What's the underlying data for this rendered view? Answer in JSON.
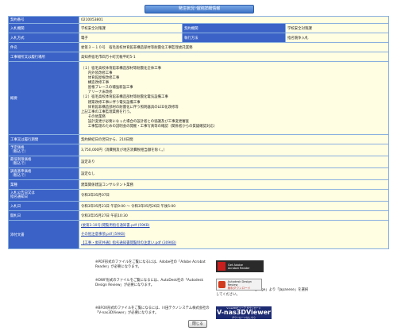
{
  "header": {
    "title": "発注状況･個別詳細情報"
  },
  "labels": {
    "contract_no": "契約番号",
    "bid_org": "入札機関",
    "contract_org": "契約機関",
    "bid_type": "入札方式",
    "exec_method": "執行方法",
    "subject": "件名",
    "site": "工事場所又は履行場所",
    "overview": "概要",
    "period": "工事又は履行期間",
    "planned_price": "予定価格\n（税込で）",
    "min_limit": "最低制限価格\n（税込で）",
    "survey_base": "調査基準価格\n（税込で）",
    "industry": "業種",
    "notice_date": "入札公告日又は\n指名通知日",
    "bid_date": "入札日",
    "open_date": "開札日",
    "attachments": "添付文書"
  },
  "values": {
    "contract_no": "0210053801",
    "bid_org": "学校安全対策課",
    "contract_org": "学校安全対策課",
    "bid_type": "電子",
    "exec_method": "指名競争入札",
    "subject": "委第３－１０号　宿毛高校体育館非構造部材等耐震化工事監理委託業務",
    "site": "高知県宿毛市四万十町元帳平町5-1",
    "overview": "（１）宿毛高校体育館非構造部材等耐震化全体工事\n　　内外装改修工事\n　　体育館屋根改修工事\n　　構造改修工事\n　　屋根ブレースの補強新設工事\n　　アリーナ床改修\n（２）宿毛高校体育館非構造部材等耐震化電気設備工事\n　　建築改修工事に伴う電気設備工事\n　　体育館非構造部材の耐震化に伴う照明器具のLED化改修等\n上記工事の工事監理業務を行う。\n　　その他業務\n　　設計変更が必要になった場合の設計者との協議及び工事変更審査\n　　工事監理のための説明会の開催・工事写真等の確認（関係者からの質疑確認対応）",
    "period": "契約締結日の翌日から、210日間",
    "planned_price": "3,750,000円（消費税及び地方消費税相当額を除く。）",
    "min_limit": "設定あり",
    "survey_base": "設定なし",
    "industry": "建築関係建設コンサルタント業務",
    "notice_date": "令和3年05月07日",
    "bid_date": "令和3年05月21日 午前9:00 ～ 令和3年05月26日 午後5:00",
    "open_date": "令和3年05月27日 午前10:30"
  },
  "attachments": [
    "(委第3-10号)閲覧用指名通知書.pdf (59KB)",
    "その他注意事項.pdf (59KB)",
    "【工事・委託共通】指名通知書閲覧時の注意い.pdf (309KB)"
  ],
  "notes": {
    "pdf": "※PDF形式のファイルをご覧になるには、Adobe社の「Adobe Acrobat Reader」が必要になります。",
    "dwf": "※DWF形式のファイルをご覧になるには、AutoDesk社の「Autodesk Design Review」が必要になります。",
    "dwf_lang": "「Choose Your MSI Language」より「Japanese」を選択してください。",
    "bfo": "※BFOX形式のファイルをご覧になるには、川田テクノシステム株式会社の「V-nas3DViewer」が必要になります。"
  },
  "badges": {
    "adobe_line1": "Get Adobe",
    "adobe_line2": "Acrobat Reader",
    "autodesk_line1": "Autodesk Design Review",
    "autodesk_line2": "無料ダウンロード",
    "vnas_top": "V-nas3Dビューア ダウンロード",
    "vnas_main": "V-nas3DViewer",
    "vnas_bottom": "ダウンロードはこちら"
  },
  "buttons": {
    "close": "閉じる"
  }
}
